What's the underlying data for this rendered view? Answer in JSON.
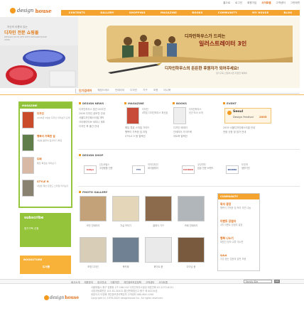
{
  "top_links": [
    "홈으로",
    "로그인",
    "회원가입",
    "사이트맵",
    "고객센터",
    "그린에셋"
  ],
  "top_links_active_index": 3,
  "logo": {
    "part1": "design",
    "part2": "house"
  },
  "nav": [
    "CONTENTS",
    "GALLERY",
    "SHOPPING",
    "MAGAZINE",
    "BOOKS",
    "COMMUNITY",
    "MY HOUSE",
    "BLOG"
  ],
  "hero": {
    "left_small": "자신의 이름이 있는",
    "left_big": "디자인 전문 쇼핑몰",
    "left_sub": "DESIGN YOUR LIFE WITH DESIGNHOUSE 2006",
    "band_title": "디자인하우스가 드리는",
    "band_title2": "일러스트레이터 3인",
    "caption": "디자인하우스의 든든한 후원자가 되어주세요!",
    "caption_highlight": "후원자가",
    "sub": "정기구독 신청하시면 다양한 혜택이"
  },
  "subnav": {
    "lead": "인기검색어",
    "items": [
      "웨딩드레스",
      "인테리어",
      "디자인",
      "가구",
      "조명",
      "미니북"
    ]
  },
  "magazine": {
    "head": "MAGAZINE",
    "items": [
      {
        "title": "디자인",
        "text": "2006년 4월호 디자인 미리보기 요약"
      },
      {
        "title": "행복이 가득한 집",
        "text": "4월호 봄맞이 집꾸미기 특집"
      },
      {
        "title": "도베",
        "text": "웨딩 특집호 미리보기"
      },
      {
        "title": "STYLE H",
        "text": "4월호 패션 트렌드 스타일 미리보기"
      }
    ]
  },
  "subscribe": {
    "title": "subscribe",
    "text": "정기구독 신청"
  },
  "bookstore": {
    "title": "BOOKSTORE",
    "text": "도서몰"
  },
  "sections": {
    "design_news": {
      "title": "DESIGN NEWS",
      "items": [
        "디자인하우스 창간 20주년",
        "2006 디자인 공모전 안내",
        "서울디자인페스티벌 개막",
        "크리에이티브 세미나 개최",
        "디자인 북 출간 안내"
      ]
    },
    "magazine_news": {
      "title": "MAGAZINE",
      "line1": "디자인",
      "line2": "4월호 디자인하우스 최신호",
      "items": [
        "웨딩 특집 스타일 가이드",
        "행복이 가득한 집 리빙",
        "STYLE H 봄 컬렉션"
      ]
    },
    "books": {
      "title": "BOOKS",
      "line1": "디자인하우스",
      "line2": "신간 도서 소개",
      "items": [
        "디자인 에세이",
        "인테리어 가이드북",
        "아트북 컬렉션"
      ]
    },
    "event": {
      "title": "EVENT",
      "badge_title": "Seoul",
      "badge_text": "Design Festival",
      "badge_year": "2005",
      "items": [
        "2005 서울디자인페스티벌 안내",
        "관람 신청 및 참가 안내"
      ]
    }
  },
  "design_shop": {
    "title": "DESIGN SHOP",
    "brands": [
      {
        "logo": "kotips",
        "lines": [
          "(주)코팁스",
          "주방용품 전문"
        ],
        "color": "#d32f2f"
      },
      {
        "logo": "YiYi",
        "lines": [
          "이이디자인",
          "테이블웨어"
        ],
        "color": "#2a3f7a"
      },
      {
        "logo": "CUCKOO",
        "lines": [
          "쿠쿠전자",
          "밥솥 전문 브랜드"
        ],
        "color": "#c62828"
      },
      {
        "logo": "DOUMA",
        "lines": [
          "도우마",
          "생활가전"
        ],
        "color": "#1e3f8a"
      }
    ]
  },
  "photo_gallery": {
    "title": "PHOTO GALLERY",
    "photos": [
      {
        "caption": "모던 인테리어",
        "color": "#c3a27a"
      },
      {
        "caption": "거실 꾸미기",
        "color": "#e4d6b8"
      },
      {
        "caption": "클래식 가구",
        "color": "#8c6a4c"
      },
      {
        "caption": "카페 인테리어",
        "color": "#b0b6b9"
      },
      {
        "caption": "조명 디자인",
        "color": "#d8cdb7"
      },
      {
        "caption": "북카페",
        "color": "#6f8193"
      },
      {
        "caption": "화이트 룸",
        "color": "#eaeaea"
      },
      {
        "caption": "다이닝 룸",
        "color": "#7a5a3e"
      },
      {
        "caption": "모던 키친",
        "color": "#a8a8a8"
      },
      {
        "caption": "서재",
        "color": "#c9bb9c"
      }
    ]
  },
  "community": {
    "head": "COMMUNITY",
    "items": [
      {
        "title": "독자 광장",
        "text": "행복이 가득한 집 독자 의견 나눔"
      },
      {
        "title": "이벤트 당첨자",
        "text": "4월 이벤트 당첨자 발표"
      },
      {
        "title": "행복 나누기",
        "text": "회원간 정보 교류 게시판"
      },
      {
        "title": "Q&A",
        "text": "자주 묻는 질문과 답변 모음"
      }
    ]
  },
  "bottom_links": [
    "회사소개",
    "제휴문의",
    "광고안내",
    "이용약관",
    "개인정보보호정책",
    "고객센터",
    "사이트맵"
  ],
  "family_site": "Family Site",
  "family_go": "GO",
  "footer": {
    "logo_part1": "design",
    "logo_part2": "house",
    "lines": [
      "서울특별시 중구 장충동 1가 186-210 디자인하우스빌딩 대표전화 02-2275-6151",
      "사업자등록번호 101-81-50412 통신판매업신고 중구 제 00234호",
      "대표이사 이영혜 개인정보관리책임자 고객센터 080-800-1200",
      "Copyright (c) 1976-2005 designhouse inc. All rights reserved."
    ]
  }
}
